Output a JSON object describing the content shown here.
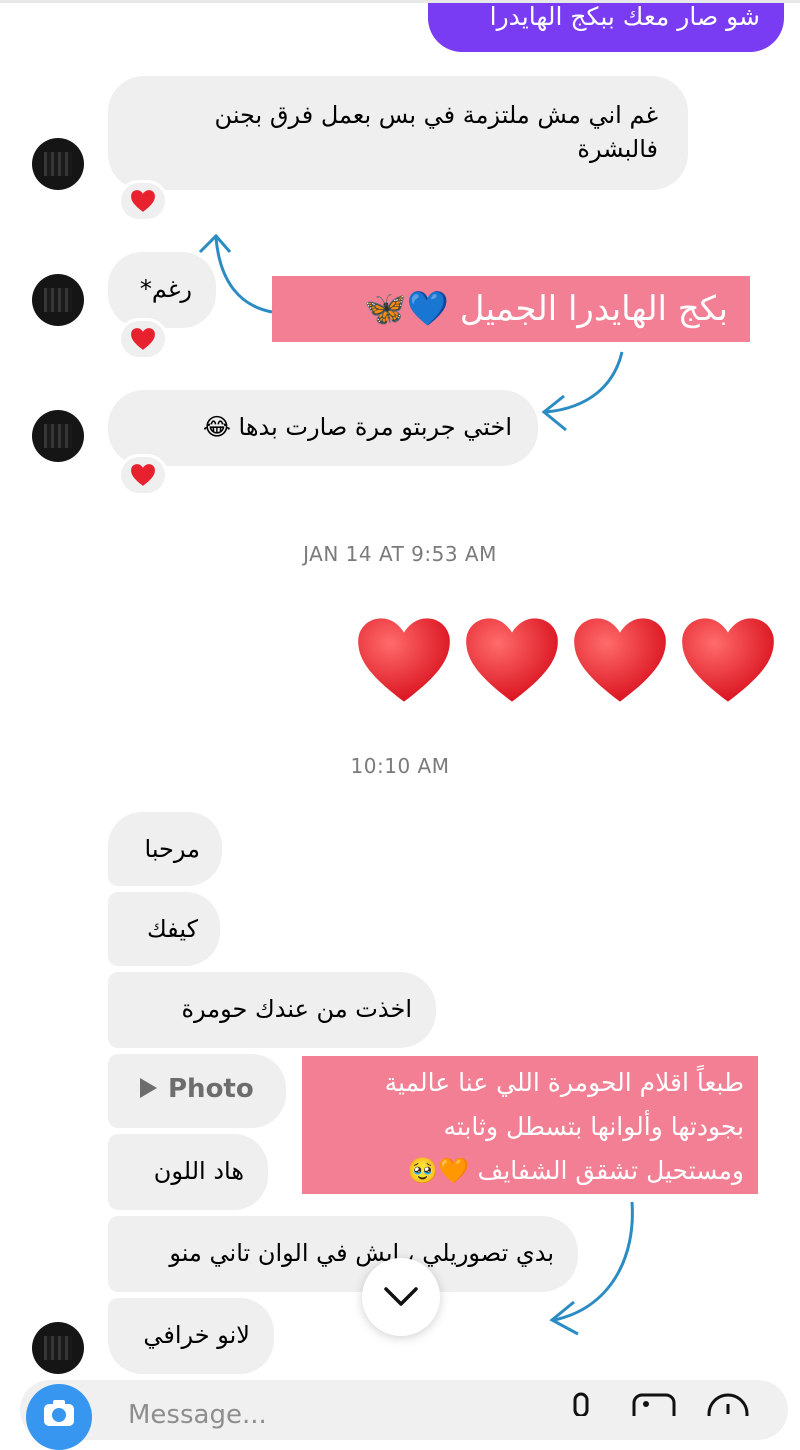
{
  "header_partial": {
    "outgoing_text": "شو صار معك ببكج الهايدرا"
  },
  "thread_top": [
    {
      "text_line1": "غم اني مش ملتزمة في  بس بعمل فرق بجنن",
      "text_line2": "فالبشرة",
      "reaction": "heart"
    },
    {
      "text": "رغم*",
      "reaction": "heart"
    },
    {
      "text": "اختي  جربتو مرة صارت بدها 😂",
      "reaction": "heart"
    }
  ],
  "timestamps": {
    "first": "JAN 14 AT 9:53 AM",
    "second": "10:10 AM"
  },
  "outgoing_hearts": {
    "count": 4,
    "emoji": "red-heart"
  },
  "thread_bottom": [
    {
      "text": "مرحبا"
    },
    {
      "text": "كيفك"
    },
    {
      "text": "اخذت من عندك حومرة"
    },
    {
      "text": "Photo"
    },
    {
      "text": "هاد اللون"
    },
    {
      "text": "بدي تصوريلي ، ايش في الوان تاني منو"
    },
    {
      "text": "لانو خرافي"
    }
  ],
  "annotations": {
    "banner1": {
      "text": "بكج الهايدرا الجميل 💙🦋"
    },
    "banner2": {
      "line1": "طبعاً اقلام الحومرة اللي عنا عالمية",
      "line2": "بجودتها وألوانها بتسطل وثابته",
      "line3": "ومستحيل تشقق الشفايف 🧡🥹"
    }
  },
  "composer": {
    "placeholder": "Message..."
  },
  "colors": {
    "outgoing": "#7a3cf2",
    "incoming": "#efefef",
    "annotation_box": "#f27f93",
    "arrow": "#2b8cc4",
    "accent": "#3797f0"
  }
}
